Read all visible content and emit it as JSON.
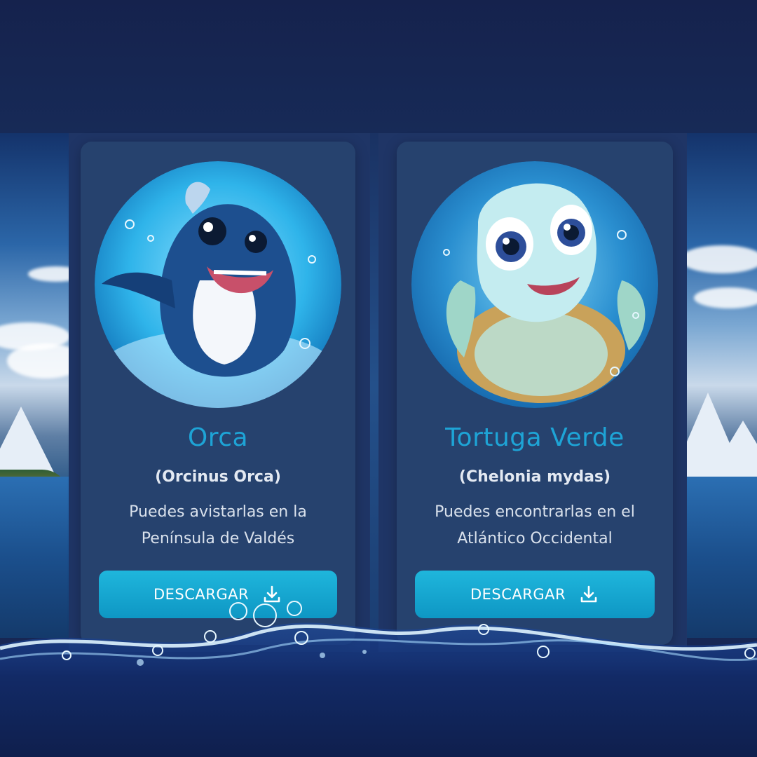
{
  "cards": [
    {
      "title": "Orca",
      "scientific_name": "(Orcinus Orca)",
      "description_line1": "Puedes avistarlas en la",
      "description_line2": "Península de Valdés",
      "button_label": "DESCARGAR",
      "avatar_icon": "orca-illustration"
    },
    {
      "title": "Tortuga Verde",
      "scientific_name": "(Chelonia mydas)",
      "description_line1": "Puedes encontrarlas en el",
      "description_line2": "Atlántico Occidental",
      "button_label": "DESCARGAR",
      "avatar_icon": "sea-turtle-illustration"
    }
  ],
  "colors": {
    "background": "#172754",
    "card": "#26426e",
    "title_accent": "#1ea4d6",
    "button": "#1fb6dc"
  }
}
